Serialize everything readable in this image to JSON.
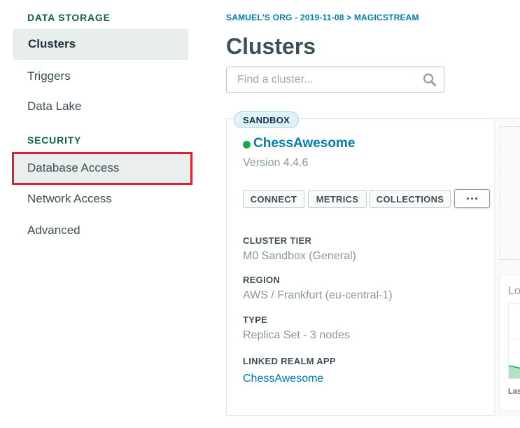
{
  "sidebar": {
    "data_storage_heading": "DATA STORAGE",
    "security_heading": "SECURITY",
    "items": [
      {
        "label": "Clusters"
      },
      {
        "label": "Triggers"
      },
      {
        "label": "Data Lake"
      },
      {
        "label": "Database Access"
      },
      {
        "label": "Network Access"
      },
      {
        "label": "Advanced"
      }
    ]
  },
  "header": {
    "breadcrumb": "SAMUEL'S ORG - 2019-11-08 > MAGICSTREAM",
    "title": "Clusters"
  },
  "search": {
    "placeholder": "Find a cluster..."
  },
  "cluster": {
    "badge": "SANDBOX",
    "name": "ChessAwesome",
    "status_color": "#13aa52",
    "version": "Version 4.4.6",
    "buttons": {
      "connect": "CONNECT",
      "metrics": "METRICS",
      "collections": "COLLECTIONS"
    },
    "tier_label": "CLUSTER TIER",
    "tier_value": "M0 Sandbox (General)",
    "region_label": "REGION",
    "region_value": "AWS / Frankfurt (eu-central-1)",
    "type_label": "TYPE",
    "type_value": "Replica Set - 3 nodes",
    "realm_label": "LINKED REALM APP",
    "realm_value": "ChessAwesome",
    "side_panel_label": "Lo",
    "side_panel_footer": "Las"
  },
  "icons": {
    "search": "search-icon",
    "more": "more-options-icon"
  },
  "colors": {
    "accent_green": "#116149",
    "link_blue": "#007cad",
    "highlight_red": "#e0202a"
  }
}
